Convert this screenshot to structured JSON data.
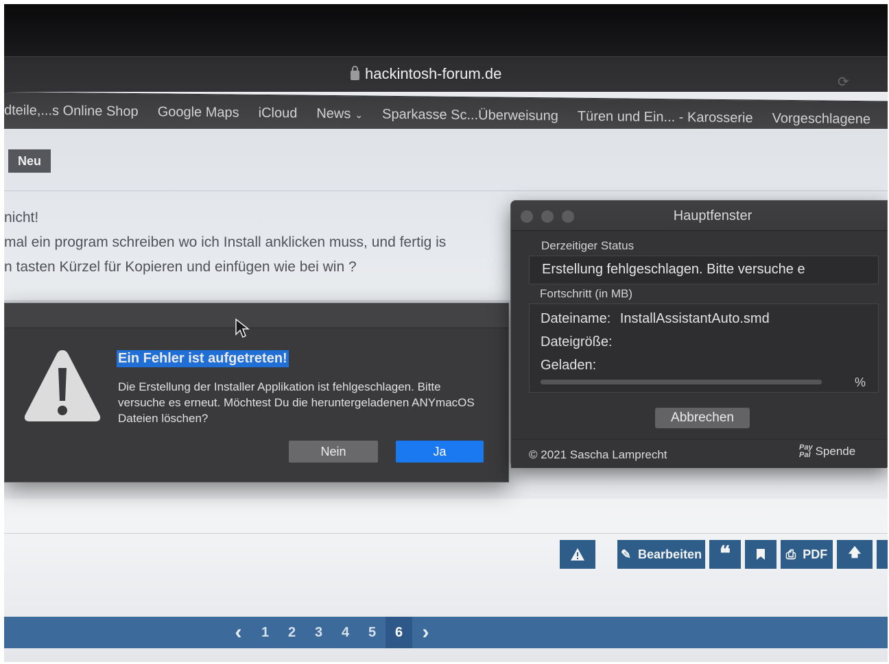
{
  "browser": {
    "url": "hackintosh-forum.de",
    "bookmarks": [
      {
        "label": "dteile,...s Online Shop"
      },
      {
        "label": "Google Maps"
      },
      {
        "label": "iCloud"
      },
      {
        "label": "News",
        "dropdown": true
      },
      {
        "label": "Sparkasse Sc...Überweisung"
      },
      {
        "label": "Türen und Ein... - Karosserie"
      },
      {
        "label": "Vorgeschlagene"
      }
    ]
  },
  "forum": {
    "new_badge": "Neu",
    "post_lines": [
      "nicht!",
      " mal ein program schreiben wo ich Install anklicken muss, und fertig is",
      "n tasten Kürzel für Kopieren und einfügen wie bei win ?"
    ],
    "actions": {
      "edit": "Bearbeiten",
      "pdf": "PDF"
    },
    "pagination": {
      "pages": [
        "1",
        "2",
        "3",
        "4",
        "5",
        "6"
      ],
      "current": "6"
    }
  },
  "alert": {
    "title": "Ein Fehler ist aufgetreten!",
    "message": "Die Erstellung der Installer Applikation ist fehlgeschlagen. Bitte versuche es erneut. Möchtest Du die  heruntergeladenen ANYmacOS Dateien löschen?",
    "no_label": "Nein",
    "yes_label": "Ja"
  },
  "app_window": {
    "title": "Hauptfenster",
    "status_label": "Derzeitiger Status",
    "status_value": "Erstellung fehlgeschlagen. Bitte versuche e",
    "progress_label": "Fortschritt (in MB)",
    "filename_label": "Dateiname:",
    "filename_value": "InstallAssistantAuto.smd",
    "filesize_label": "Dateigröße:",
    "loaded_label": "Geladen:",
    "percent_symbol": "%",
    "progress": 0,
    "cancel_label": "Abbrechen",
    "copyright": "© 2021 Sascha Lamprecht",
    "paypal_top": "Pay",
    "paypal_bottom": "Pal",
    "donate_label": "Spende"
  },
  "colors": {
    "accent_blue": "#1a78f0",
    "forum_blue": "#2f5d8a",
    "dialog_bg": "#3a3a3c"
  }
}
